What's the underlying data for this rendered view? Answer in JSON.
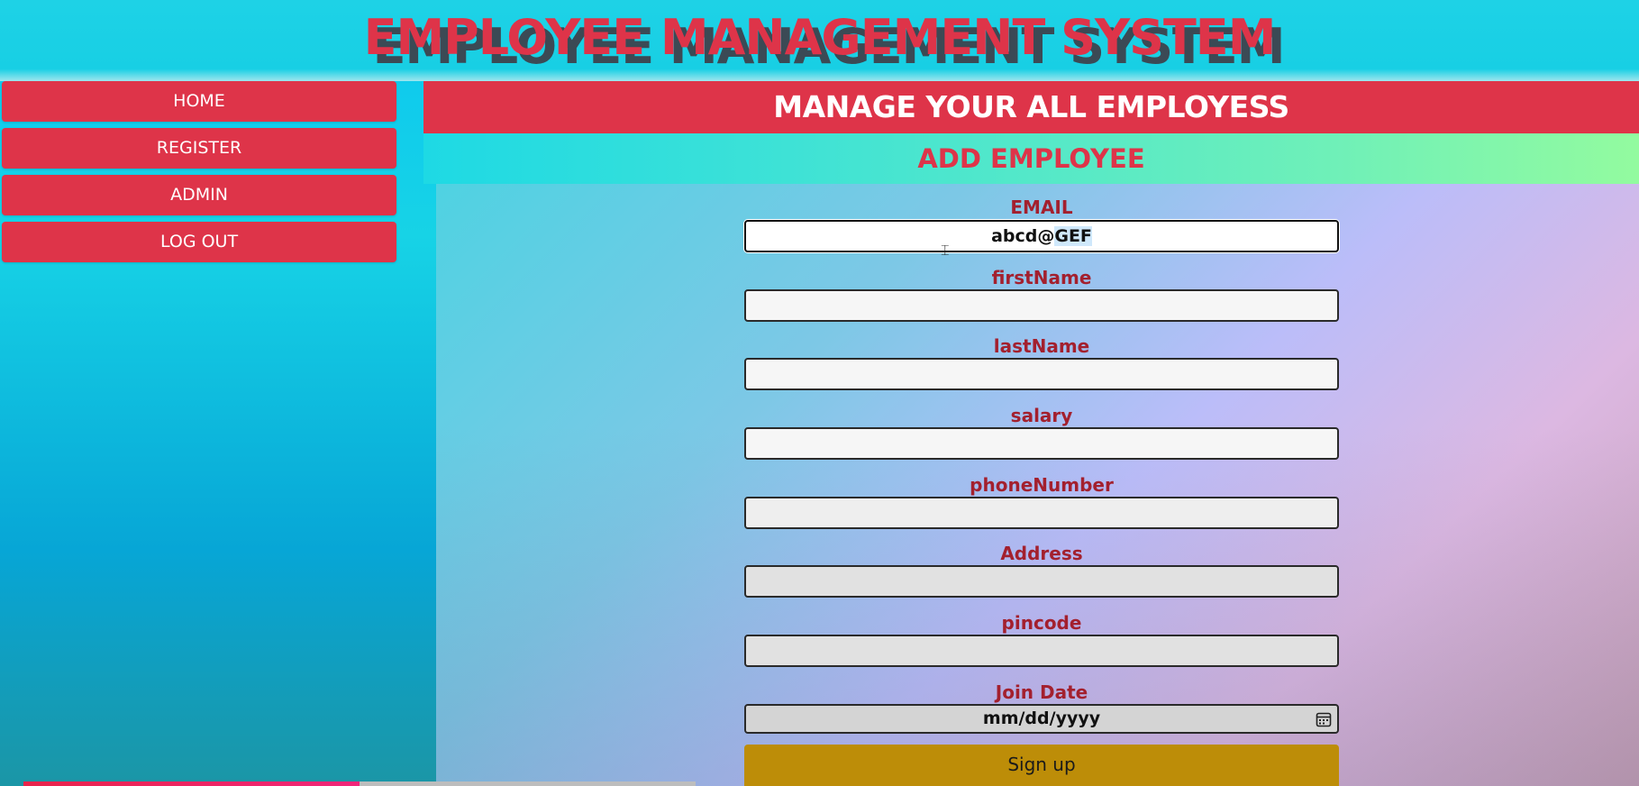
{
  "header": {
    "title": "EMPLOYEE MANAGEMENT SYSTEM"
  },
  "sidebar": {
    "items": [
      {
        "label": "HOME"
      },
      {
        "label": "REGISTER"
      },
      {
        "label": "ADMIN"
      },
      {
        "label": "LOG OUT"
      }
    ]
  },
  "main": {
    "banner": "MANAGE YOUR ALL EMPLOYESS",
    "subtitle": "ADD EMPLOYEE"
  },
  "form": {
    "email_label": "EMAIL",
    "email_value_plain": "abcd@",
    "email_value_selected": "GEF",
    "firstname_label": "firstName",
    "lastname_label": "lastName",
    "salary_label": "salary",
    "phone_label": "phoneNumber",
    "address_label": "Address",
    "pincode_label": "pincode",
    "joindate_label": "Join Date",
    "joindate_placeholder": "mm/dd/yyyy",
    "submit_label": "Sign up"
  },
  "colors": {
    "accent_red": "#de3449",
    "label_red": "#a3202e",
    "submit_gold": "#bd8d08"
  },
  "scrollbar": {
    "position_fraction": 0.5
  }
}
